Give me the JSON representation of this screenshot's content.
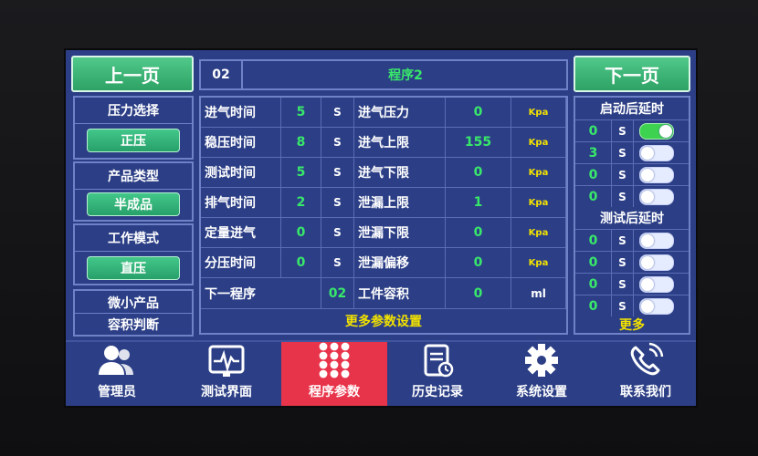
{
  "header": {
    "prev_label": "上一页",
    "next_label": "下一页",
    "program_number": "02",
    "program_title": "程序2"
  },
  "left": {
    "pressure_title": "压力选择",
    "pressure_value": "正压",
    "product_title": "产品类型",
    "product_value": "半成品",
    "mode_title": "工作模式",
    "mode_value": "直压",
    "micro_line1": "微小产品",
    "micro_line2": "容积判断"
  },
  "params": {
    "left": [
      {
        "label": "进气时间",
        "value": "5",
        "unit": "S"
      },
      {
        "label": "稳压时间",
        "value": "8",
        "unit": "S"
      },
      {
        "label": "测试时间",
        "value": "5",
        "unit": "S"
      },
      {
        "label": "排气时间",
        "value": "2",
        "unit": "S"
      },
      {
        "label": "定量进气",
        "value": "0",
        "unit": "S"
      },
      {
        "label": "分压时间",
        "value": "0",
        "unit": "S"
      }
    ],
    "right": [
      {
        "label": "进气压力",
        "value": "0",
        "unit": "Kpa"
      },
      {
        "label": "进气上限",
        "value": "155",
        "unit": "Kpa"
      },
      {
        "label": "进气下限",
        "value": "0",
        "unit": "Kpa"
      },
      {
        "label": "泄漏上限",
        "value": "1",
        "unit": "Kpa"
      },
      {
        "label": "泄漏下限",
        "value": "0",
        "unit": "Kpa"
      },
      {
        "label": "泄漏偏移",
        "value": "0",
        "unit": "Kpa"
      }
    ],
    "next_program_label": "下一程序",
    "next_program_value": "02",
    "workpiece_label": "工件容积",
    "workpiece_value": "0",
    "workpiece_unit": "ml",
    "more_settings": "更多参数设置"
  },
  "delays": {
    "start_title": "启动后延时",
    "start_rows": [
      {
        "value": "0",
        "unit": "S",
        "on": true
      },
      {
        "value": "3",
        "unit": "S",
        "on": false
      },
      {
        "value": "0",
        "unit": "S",
        "on": false
      },
      {
        "value": "0",
        "unit": "S",
        "on": false
      }
    ],
    "test_title": "测试后延时",
    "test_rows": [
      {
        "value": "0",
        "unit": "S",
        "on": false
      },
      {
        "value": "0",
        "unit": "S",
        "on": false
      },
      {
        "value": "0",
        "unit": "S",
        "on": false
      },
      {
        "value": "0",
        "unit": "S",
        "on": false
      }
    ],
    "more": "更多"
  },
  "nav": [
    {
      "label": "管理员",
      "icon": "users-icon"
    },
    {
      "label": "测试界面",
      "icon": "monitor-pulse-icon"
    },
    {
      "label": "程序参数",
      "icon": "keypad-icon",
      "active": true
    },
    {
      "label": "历史记录",
      "icon": "document-history-icon"
    },
    {
      "label": "系统设置",
      "icon": "gear-icon"
    },
    {
      "label": "联系我们",
      "icon": "phone-icon"
    }
  ],
  "colors": {
    "screen_bg": "#2c3f86",
    "green_button": "#3fbf7f",
    "value_green": "#38e86a",
    "accent_yellow": "#f2e200",
    "active_nav": "#e8344a"
  }
}
